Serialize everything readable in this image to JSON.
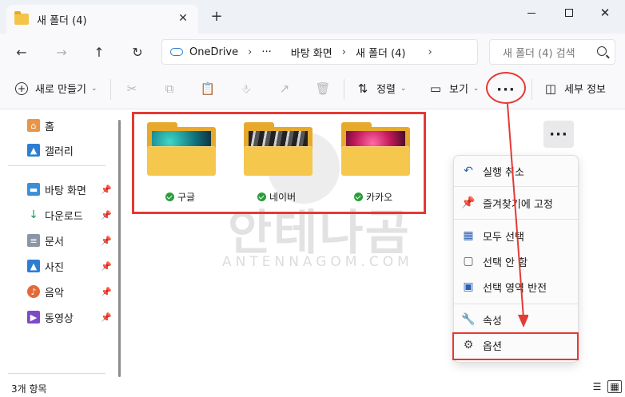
{
  "window": {
    "tab_title": "새 폴더 (4)",
    "tab_close": "✕",
    "new_tab": "+",
    "close": "✕"
  },
  "nav": {
    "back": "←",
    "forward": "→",
    "up": "↑",
    "refresh": "↻",
    "breadcrumb": [
      "OneDrive",
      "›",
      "···",
      "바탕 화면",
      "›",
      "새 폴더 (4)",
      "›"
    ],
    "search_placeholder": "새 폴더 (4) 검색"
  },
  "toolbar": {
    "new_label": "새로 만들기",
    "sort_label": "정렬",
    "view_label": "보기",
    "more_label": "···",
    "details_label": "세부 정보"
  },
  "sidebar": {
    "items": [
      {
        "label": "홈",
        "icon": "home-icon"
      },
      {
        "label": "갤러리",
        "icon": "gallery-icon"
      },
      {
        "label": "바탕 화면",
        "icon": "desktop-icon",
        "pinned": true
      },
      {
        "label": "다운로드",
        "icon": "download-icon",
        "pinned": true
      },
      {
        "label": "문서",
        "icon": "document-icon",
        "pinned": true
      },
      {
        "label": "사진",
        "icon": "pictures-icon",
        "pinned": true
      },
      {
        "label": "음악",
        "icon": "music-icon",
        "pinned": true
      },
      {
        "label": "동영상",
        "icon": "video-icon",
        "pinned": true
      }
    ]
  },
  "files": [
    {
      "name": "구글",
      "status": "synced"
    },
    {
      "name": "네이버",
      "status": "synced"
    },
    {
      "name": "카카오",
      "status": "synced"
    }
  ],
  "context_menu": {
    "trigger": "···",
    "items": [
      {
        "label": "실행 취소",
        "icon": "undo-icon"
      },
      {
        "label": "즐겨찾기에 고정",
        "icon": "pin-icon"
      },
      {
        "label": "모두 선택",
        "icon": "select-all-icon"
      },
      {
        "label": "선택 안 함",
        "icon": "select-none-icon"
      },
      {
        "label": "선택 영역 반전",
        "icon": "invert-selection-icon"
      },
      {
        "label": "속성",
        "icon": "properties-icon"
      },
      {
        "label": "옵션",
        "icon": "gear-icon"
      }
    ]
  },
  "watermark": {
    "main": "안테나곰",
    "sub": "ANTENNAGOM.COM"
  },
  "status": {
    "item_count": "3개 항목"
  },
  "colors": {
    "accent": "#2b7cd3",
    "highlight_red": "#e53935",
    "folder_yellow": "#f5c84d",
    "sync_green": "#2a9d3a"
  }
}
